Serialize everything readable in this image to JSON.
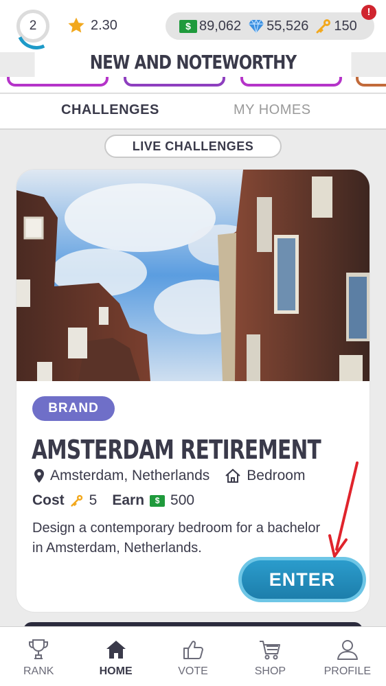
{
  "status": {
    "level": "2",
    "rating": "2.30",
    "cash": "89,062",
    "gems": "55,526",
    "keys": "150",
    "alert": "!"
  },
  "section": {
    "title": "NEW AND NOTEWORTHY"
  },
  "tabs": [
    {
      "label": "CHALLENGES",
      "active": true
    },
    {
      "label": "MY HOMES",
      "active": false
    }
  ],
  "filter": {
    "label": "LIVE CHALLENGES"
  },
  "challenge": {
    "badge": "BRAND",
    "title": "AMSTERDAM RETIREMENT",
    "location": "Amsterdam, Netherlands",
    "room": "Bedroom",
    "cost_label": "Cost",
    "cost_value": "5",
    "earn_label": "Earn",
    "earn_value": "500",
    "description": "Design a contemporary bedroom for a bachelor in Amsterdam, Netherlands.",
    "enter_label": "ENTER"
  },
  "nav": [
    {
      "label": "RANK",
      "icon": "trophy-icon"
    },
    {
      "label": "HOME",
      "icon": "house-icon",
      "active": true
    },
    {
      "label": "VOTE",
      "icon": "thumbs-up-icon"
    },
    {
      "label": "SHOP",
      "icon": "cart-icon"
    },
    {
      "label": "PROFILE",
      "icon": "person-icon"
    }
  ],
  "colors": {
    "accent_blue": "#2b9ccc",
    "brand_badge": "#6f6fc8",
    "cash_green": "#1f9a3c",
    "alert_red": "#d0252f",
    "annotation_red": "#e0242c"
  }
}
